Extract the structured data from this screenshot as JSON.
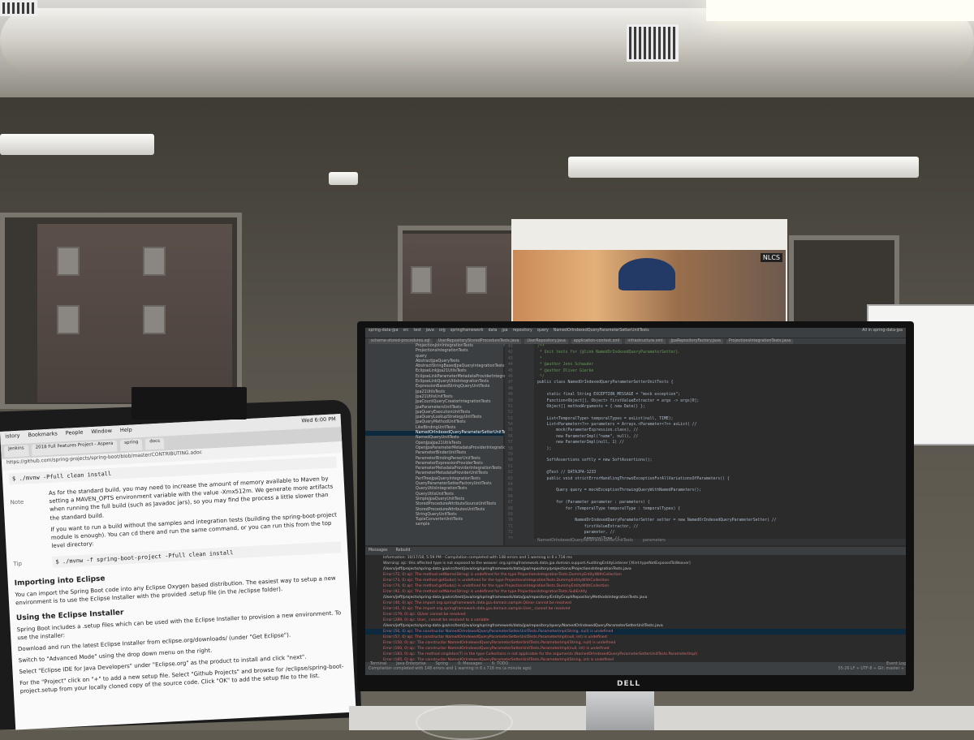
{
  "laptop": {
    "menubar": [
      "istory",
      "Bookmarks",
      "People",
      "Window",
      "Help",
      "Wed 6:00 PM"
    ],
    "tabs": [
      "Jenkins",
      "2018 Full Features Project - Aspera",
      "spring",
      "docs"
    ],
    "address": "https://github.com/spring-projects/spring-boot/blob/master/CONTRIBUTING.adoc",
    "cmd1": "$ ./mvnw -Pfull clean install",
    "note_label": "Note",
    "note_text": "As for the standard build, you may need to increase the amount of memory available to Maven by setting a MAVEN_OPTS environment variable with the value -Xmx512m. We generate more artifacts when running the full build (such as Javadoc jars), so you may find the process a little slower than the standard build.",
    "note_text2": "If you want to run a build without the samples and integration tests (building the spring-boot-project module is enough). You can cd there and run the same command, or you can run this from the top level directory:",
    "tip_label": "Tip",
    "cmd2": "$ ./mvnw -f spring-boot-project -Pfull clean install",
    "h_importing": "Importing into Eclipse",
    "p_importing": "You can import the Spring Boot code into any Eclipse Oxygen based distribution. The easiest way to setup a new environment is to use the Eclipse Installer with the provided .setup file (in the /eclipse folder).",
    "h_installer": "Using the Eclipse Installer",
    "p_installer": "Spring Boot includes a .setup files which can be used with the Eclipse Installer to provision a new environment. To use the installer:",
    "li1": "Download and run the latest Eclipse Installer from eclipse.org/downloads/ (under \"Get Eclipse\").",
    "li2": "Switch to \"Advanced Mode\" using the drop down menu on the right.",
    "li3": "Select \"Eclipse IDE for Java Developers\" under \"Eclipse.org\" as the product to install and click \"next\".",
    "li4": "For the \"Project\" click on \"+\" to add a new setup file. Select \"Github Projects\" and browse for /eclipse/spring-boot-project.setup from your locally cloned copy of the source code. Click \"OK\" to add the setup file to the list."
  },
  "ide": {
    "breadcrumb": [
      "spring-data-jpa",
      "src",
      "test",
      "java",
      "org",
      "springframework",
      "data",
      "jpa",
      "repository",
      "query",
      "NamedOrIndexedQueryParameterSetterUnitTests"
    ],
    "run_config": "All in spring-data-jpa",
    "tabs": [
      "scheme-stored-procedures.sql",
      "UserRepositoryStoredProcedureTests.java",
      "UserRepository.java",
      "application-context.xml",
      "infrastructure.xml",
      "JpaRepositoryFactory.java",
      "ProjectionsIntegrationTests.java"
    ],
    "tree": [
      "ProjectionJoinIntegrationTests",
      "ProjectionsIntegrationTests",
      "query",
      "AbstractJpaQueryTests",
      "AbstractStringBasedJpaQueryIntegrationTests",
      "EclipseLinkJpa21UtilsTests",
      "EclipseLinkParameterMetadataProviderIntegrationTests",
      "EclipseLinkQueryUtilsIntegrationTests",
      "ExpressionBasedStringQueryUnitTests",
      "Jpa21UtilsTests",
      "Jpa21UtilsUnitTests",
      "JpaCountQueryCreatorIntegrationTests",
      "JpaParametersUnitTests",
      "JpaQueryExecutionUnitTests",
      "JpaQueryLookupStrategyUnitTests",
      "JpaQueryMethodUnitTests",
      "LikeBindingUnitTests",
      "NamedOrIndexedQueryParameterSetterUnitTests",
      "NamedQueryUnitTests",
      "OpenJpaJpa21UtilsTests",
      "OpenJpaParameterMetadataProviderIntegrationTests",
      "ParameterBinderUnitTests",
      "ParameterBindingParserUnitTests",
      "ParameterExpressionProviderTests",
      "ParameterMetadataProviderIntegrationTests",
      "ParameterMetadataProviderUnitTests",
      "PartTreeJpaQueryIntegrationTests",
      "QueryParameterSetterFactoryUnitTests",
      "QueryUtilsIntegrationTests",
      "QueryUtilsUnitTests",
      "SimpleJpaQueryUnitTests",
      "StoredProcedureAttributeSourceUnitTests",
      "StoredProcedureAttributesUnitTests",
      "StringQueryUnitTests",
      "TupleConverterUnitTests",
      "sample"
    ],
    "gutter": [
      "41",
      "42",
      "43",
      "44",
      "45",
      "46",
      "47",
      "48",
      "49",
      "50",
      "51",
      "52",
      "53",
      "54",
      "55",
      "56",
      "57",
      "58",
      "59",
      "60",
      "61",
      "62",
      "63",
      "64",
      "65",
      "66",
      "67",
      "68",
      "69",
      "70",
      "71",
      "72",
      "73"
    ],
    "code": [
      "/**",
      " * Unit tests for {@link NamedOrIndexedQueryParameterSetter}.",
      " *",
      " * @author Jens Schauder",
      " * @author Oliver Gierke",
      " */",
      "public class NamedOrIndexedQueryParameterSetterUnitTests {",
      "",
      "    static final String EXCEPTION_MESSAGE = \"mock exception\";",
      "    Function<Object[], Object> firstValueExtractor = args -> args[0];",
      "    Object[] methodArguments = { new Date() };",
      "",
      "    List<TemporalType> temporalTypes = asList(null, TIME);",
      "    List<Parameter<?>> parameters = Arrays.<Parameter<?>> asList( //",
      "        mock(ParameterExpression.class), //",
      "        new ParameterImpl(\"name\", null), //",
      "        new ParameterImpl(null, 1) //",
      "    );",
      "",
      "    SoftAssertions softly = new SoftAssertions();",
      "",
      "    @Test // DATAJPA-1233",
      "    public void strictErrorHandlingThrowsExceptionForAllVariationsOfParameters() {",
      "",
      "        Query query = mockExceptionThrowingQueryWithNamedParameters();",
      "",
      "        for (Parameter parameter : parameters) {",
      "            for (TemporalType temporalType : temporalTypes) {",
      "",
      "                NamedOrIndexedQueryParameterSetter setter = new NamedOrIndexedQueryParameterSetter( //",
      "                    firstValueExtractor, //",
      "                    parameter, //",
      "                    temporalType //"
    ],
    "editor_footer": [
      "NamedOrIndexedQueryParameterSetterUnitTests",
      "parameters"
    ],
    "messages_title": "Messages",
    "messages_tab": "Rebuild",
    "messages": [
      "Information: 10/17/18, 5:59 PM - Compilation completed with 148 errors and 1 warning in 6 s 718 ms",
      "Warning: ajc: this affected type is not exposed to the weaver: org.springframework.data.jpa.domain.support.AuditingEntityListener [Xlint:typeNotExposedToWeaver]",
      "/Users/jeff/projects/spring-data-jpa/src/test/java/org/springframework/data/jpa/repository/projections/ProjectionsIntegrationTests.java",
      "Error:(72, 0) ajc: The method setName(String) is undefined for the type ProjectionsIntegrationTests.DummyEntityWithCollection",
      "Error:(73, 0) ajc: The method getSubs() is undefined for the type ProjectionsIntegrationTests.DummyEntityWithCollection",
      "Error:(74, 0) ajc: The method getSubs() is undefined for the type ProjectionsIntegrationTests.DummyEntityWithCollection",
      "Error:(92, 0) ajc: The method setName(String) is undefined for the type ProjectionsIntegrationTests.SubEntity",
      "/Users/jeff/projects/spring-data-jpa/src/test/java/org/springframework/data/jpa/repository/EntityGraphRepositoryMethodsIntegrationTests.java",
      "Error:(40, 0) ajc: The import org.springframework.data.jpa.domain.sample.QUser cannot be resolved",
      "Error:(41, 0) ajc: The import org.springframework.data.jpa.domain.sample.User_ cannot be resolved",
      "Error:(179, 0) ajc: QUser cannot be resolved",
      "Error:(289, 0) ajc: User_ cannot be resolved to a variable",
      "/Users/jeff/projects/spring-data-jpa/src/test/java/org/springframework/data/jpa/repository/query/NamedOrIndexedQueryParameterSetterUnitTests.java",
      "Error:(56, 0) ajc: The constructor NamedOrIndexedQueryParameterSetterUnitTests.ParameterImpl(String, null) is undefined",
      "Error:(57, 0) ajc: The constructor NamedOrIndexedQueryParameterSetterUnitTests.ParameterImpl(null, int) is undefined",
      "Error:(150, 0) ajc: The constructor NamedOrIndexedQueryParameterSetterUnitTests.ParameterImpl(String, null) is undefined",
      "Error:(160, 0) ajc: The constructor NamedOrIndexedQueryParameterSetterUnitTests.ParameterImpl(null, int) is undefined",
      "Error:(183, 0) ajc: The method singleton(T) in the type Collections is not applicable for the arguments (NamedOrIndexedQueryParameterSetterUnitTests.ParameterImpl)",
      "Error:(185, 0) ajc: The constructor NamedOrIndexedQueryParameterSetterUnitTests.ParameterImpl(String, int) is undefined"
    ],
    "bottom_tabs": [
      "Terminal",
      "Java Enterprise",
      "Spring",
      "0: Messages",
      "6: TODO"
    ],
    "status": "Compilation completed with 148 errors and 1 warning in 6 s 718 ms (a minute ago)",
    "status_right": "55:26  LF ÷  UTF-8 ÷  Git: master ÷",
    "event_log": "Event Log"
  },
  "monitor_brand": "DELL",
  "projector_badge": "NLCS"
}
